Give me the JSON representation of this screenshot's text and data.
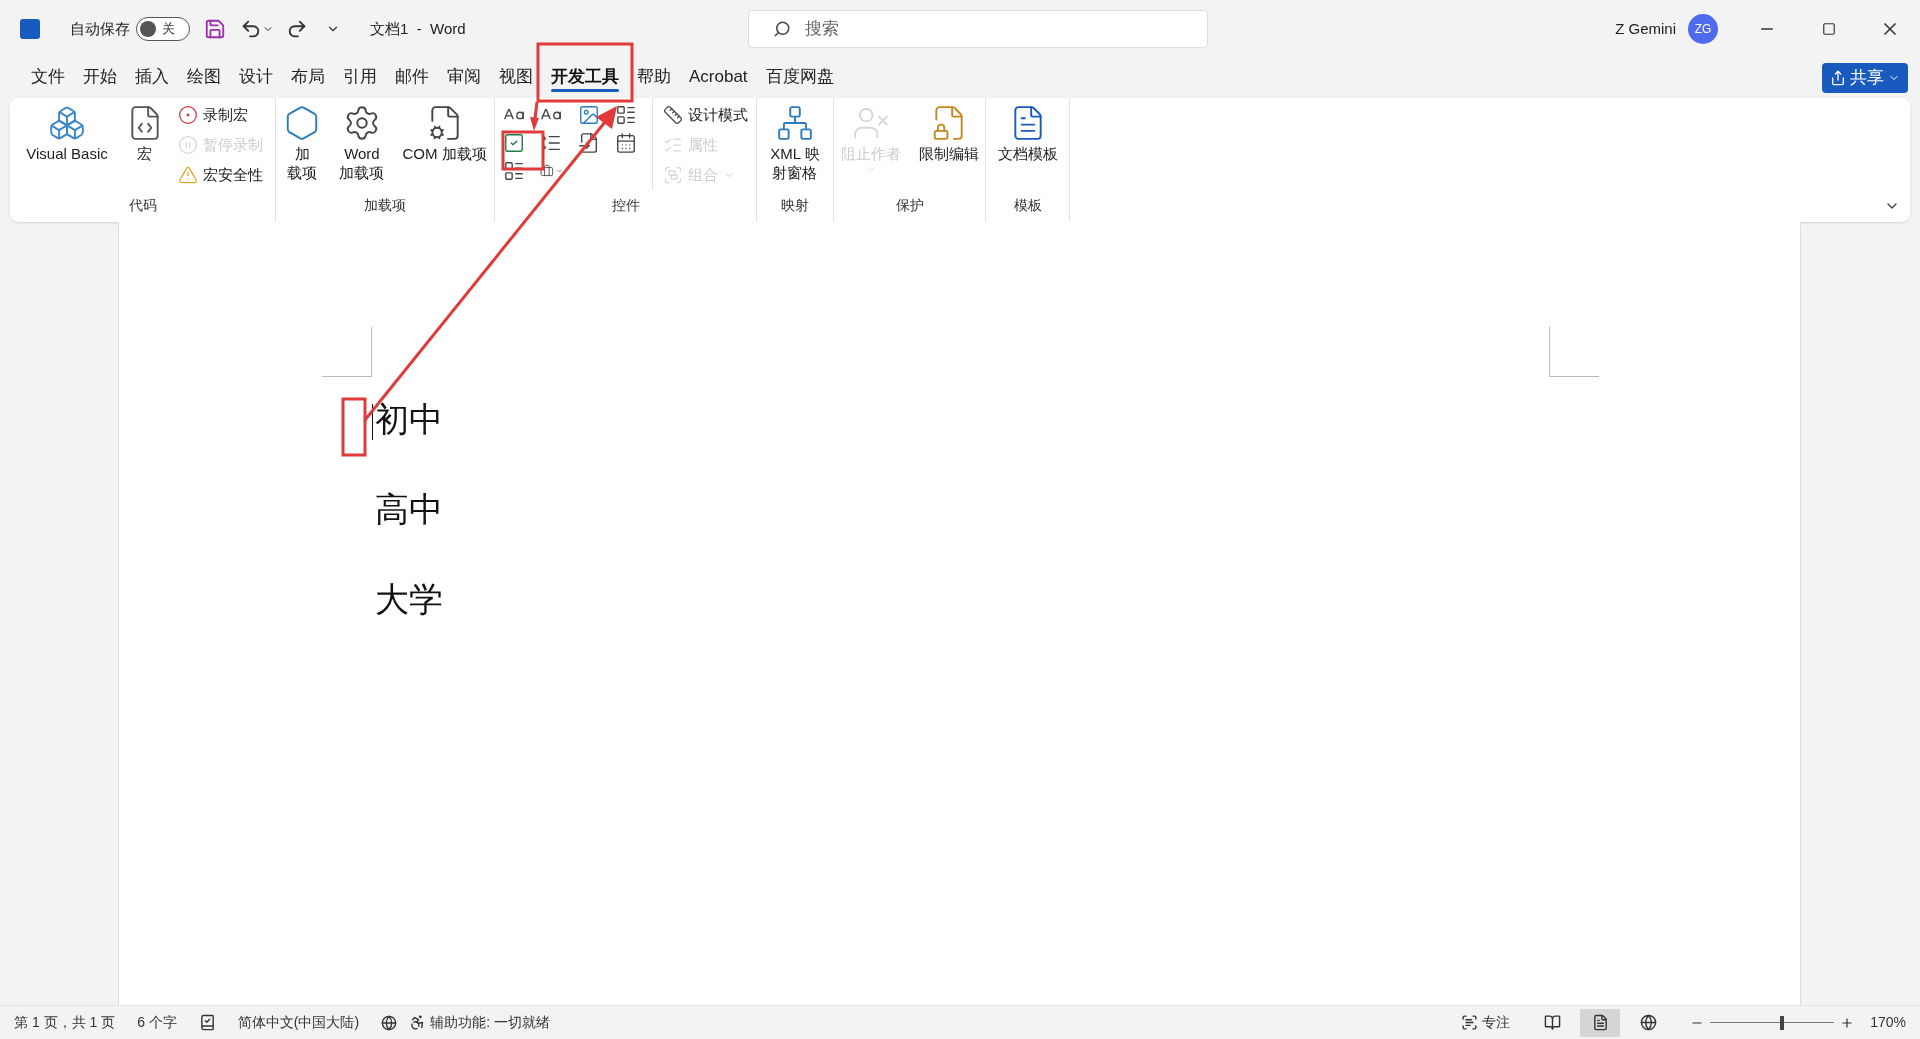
{
  "title_bar": {
    "autosave_label": "自动保存",
    "autosave": {
      "on": false,
      "label": "关"
    },
    "title": "文档1  -  Word",
    "search": {
      "placeholder": "搜索"
    },
    "user_name": "Z Gemini",
    "avatar": "ZG"
  },
  "tabs": [
    {
      "label": "文件",
      "selected": false
    },
    {
      "label": "开始",
      "selected": false
    },
    {
      "label": "插入",
      "selected": false
    },
    {
      "label": "绘图",
      "selected": false
    },
    {
      "label": "设计",
      "selected": false
    },
    {
      "label": "布局",
      "selected": false
    },
    {
      "label": "引用",
      "selected": false
    },
    {
      "label": "邮件",
      "selected": false
    },
    {
      "label": "审阅",
      "selected": false
    },
    {
      "label": "视图",
      "selected": false
    },
    {
      "label": "开发工具",
      "selected": true
    },
    {
      "label": "帮助",
      "selected": false
    },
    {
      "label": "Acrobat",
      "selected": false
    },
    {
      "label": "百度网盘",
      "selected": false
    }
  ],
  "share_button": "共享",
  "ribbon": {
    "groups": [
      {
        "label": "代码",
        "items": [
          {
            "kind": "large",
            "label": [
              "Visual Basic"
            ],
            "disabled": false
          },
          {
            "kind": "large",
            "label": [
              "宏"
            ],
            "disabled": false
          },
          {
            "kind": "small",
            "label": [
              "录制宏"
            ],
            "disabled": false
          },
          {
            "kind": "small",
            "label": [
              "暂停录制"
            ],
            "disabled": true
          },
          {
            "kind": "small",
            "label": [
              "宏安全性"
            ],
            "disabled": false
          }
        ]
      },
      {
        "label": "加载项",
        "items": [
          {
            "kind": "large",
            "label": [
              "加",
              "载项"
            ],
            "disabled": false
          },
          {
            "kind": "large",
            "label": [
              "Word",
              "加载项"
            ],
            "disabled": false
          },
          {
            "kind": "large",
            "label": [
              "COM 加载项"
            ],
            "disabled": false
          }
        ]
      },
      {
        "label": "控件",
        "items": [
          {
            "kind": "controls"
          },
          {
            "kind": "small",
            "label": [
              "设计模式"
            ],
            "disabled": false
          },
          {
            "kind": "small",
            "label": [
              "属性"
            ],
            "disabled": true
          },
          {
            "kind": "small",
            "label": [
              "组合"
            ],
            "disabled": true
          }
        ]
      },
      {
        "label": "映射",
        "items": [
          {
            "kind": "large",
            "label": [
              "XML 映",
              "射窗格"
            ],
            "disabled": false
          }
        ]
      },
      {
        "label": "保护",
        "items": [
          {
            "kind": "large",
            "label": [
              "阻止作者"
            ],
            "disabled": true
          },
          {
            "kind": "large",
            "label": [
              "限制编辑"
            ],
            "disabled": false
          }
        ]
      },
      {
        "label": "模板",
        "items": [
          {
            "kind": "large",
            "label": [
              "文档模板"
            ],
            "disabled": false
          }
        ]
      }
    ]
  },
  "document": {
    "paragraphs": [
      "初中",
      "高中",
      "大学"
    ]
  },
  "status_bar": {
    "page": "第 1 页，共 1 页",
    "words": "6 个字",
    "language": "简体中文(中国大陆)",
    "accessibility": "辅助功能: 一切就绪",
    "focus": "专注",
    "views": [
      {
        "selected": false
      },
      {
        "selected": true
      },
      {
        "selected": false
      }
    ],
    "zoom": {
      "level": 0.58,
      "reading": "170%"
    }
  }
}
